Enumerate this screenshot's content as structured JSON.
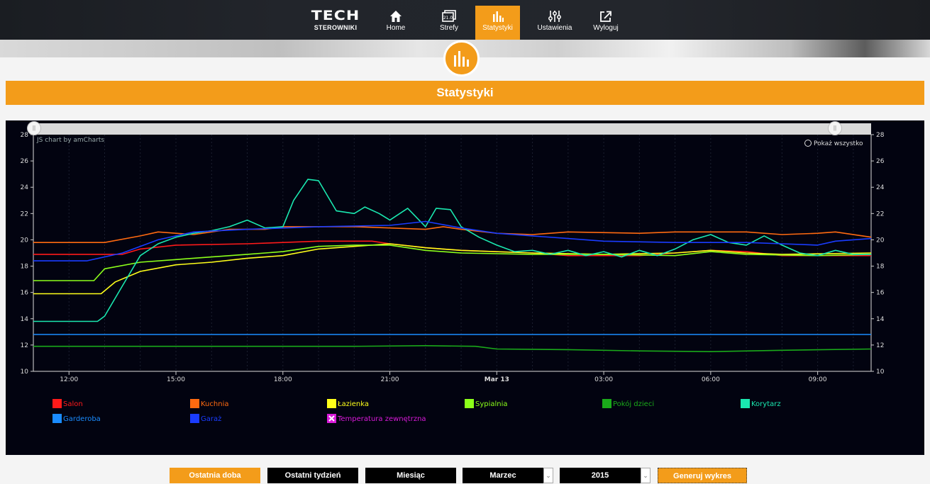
{
  "nav": {
    "logo_top": "TECH",
    "logo_bottom": "STEROWNIKI",
    "items": [
      {
        "label": "Home",
        "icon": "home-icon"
      },
      {
        "label": "Strefy",
        "icon": "zones-icon",
        "icon_text": "21.0"
      },
      {
        "label": "Statystyki",
        "icon": "bar-chart-icon",
        "active": true
      },
      {
        "label": "Ustawienia",
        "icon": "sliders-icon"
      },
      {
        "label": "Wyloguj",
        "icon": "logout-icon"
      }
    ]
  },
  "page": {
    "title": "Statystyki"
  },
  "chart_header": {
    "credit": "JS chart by amCharts",
    "zoom_out": "Pokaż wszystko"
  },
  "chart_data": {
    "type": "line",
    "y_ticks": [
      10,
      12,
      14,
      16,
      18,
      20,
      22,
      24,
      26,
      28
    ],
    "ylim": [
      10,
      28
    ],
    "xlim": [
      11.0,
      34.5
    ],
    "x_ticks": [
      {
        "x": 12,
        "label": "12:00"
      },
      {
        "x": 15,
        "label": "15:00"
      },
      {
        "x": 18,
        "label": "18:00"
      },
      {
        "x": 21,
        "label": "21:00"
      },
      {
        "x": 24,
        "label": "Mar 13",
        "bold": true
      },
      {
        "x": 27,
        "label": "03:00"
      },
      {
        "x": 30,
        "label": "06:00"
      },
      {
        "x": 33,
        "label": "09:00"
      }
    ],
    "series": [
      {
        "name": "Salon",
        "color": "#ff1a1a",
        "points": [
          [
            11,
            18.9
          ],
          [
            13.5,
            18.9
          ],
          [
            14,
            19.3
          ],
          [
            15,
            19.6
          ],
          [
            17,
            19.7
          ],
          [
            18,
            19.8
          ],
          [
            19,
            19.9
          ],
          [
            20.5,
            19.9
          ],
          [
            21,
            19.7
          ],
          [
            22,
            19.4
          ],
          [
            23,
            19.2
          ],
          [
            25,
            19.0
          ],
          [
            26,
            18.8
          ],
          [
            28,
            18.8
          ],
          [
            29,
            19.0
          ],
          [
            30,
            19.2
          ],
          [
            31,
            19.1
          ],
          [
            32,
            18.8
          ],
          [
            34.5,
            18.8
          ]
        ]
      },
      {
        "name": "Kuchnia",
        "color": "#ff6a10",
        "points": [
          [
            11,
            19.8
          ],
          [
            13,
            19.8
          ],
          [
            14,
            20.3
          ],
          [
            14.5,
            20.6
          ],
          [
            15.5,
            20.4
          ],
          [
            16.5,
            20.8
          ],
          [
            17.5,
            20.8
          ],
          [
            18,
            21.0
          ],
          [
            20,
            21.0
          ],
          [
            21,
            20.9
          ],
          [
            22,
            20.8
          ],
          [
            22.5,
            21.0
          ],
          [
            23,
            20.8
          ],
          [
            24,
            20.5
          ],
          [
            25,
            20.4
          ],
          [
            26,
            20.6
          ],
          [
            28,
            20.5
          ],
          [
            29,
            20.6
          ],
          [
            31,
            20.6
          ],
          [
            32,
            20.4
          ],
          [
            33,
            20.5
          ],
          [
            33.5,
            20.6
          ],
          [
            34.5,
            20.2
          ]
        ]
      },
      {
        "name": "Łazienka",
        "color": "#ffff1a",
        "points": [
          [
            11,
            15.9
          ],
          [
            12.9,
            15.9
          ],
          [
            13.3,
            16.8
          ],
          [
            14,
            17.6
          ],
          [
            15,
            18.1
          ],
          [
            16,
            18.3
          ],
          [
            17,
            18.6
          ],
          [
            18,
            18.8
          ],
          [
            19,
            19.3
          ],
          [
            20,
            19.5
          ],
          [
            21,
            19.7
          ],
          [
            22,
            19.4
          ],
          [
            23,
            19.2
          ],
          [
            25,
            19.0
          ],
          [
            27,
            18.9
          ],
          [
            29,
            19.0
          ],
          [
            30,
            19.2
          ],
          [
            31,
            19.0
          ],
          [
            32,
            18.9
          ],
          [
            34.5,
            19.0
          ]
        ]
      },
      {
        "name": "Sypialnia",
        "color": "#8cff1a",
        "points": [
          [
            11,
            16.9
          ],
          [
            12.7,
            16.9
          ],
          [
            13,
            17.8
          ],
          [
            14,
            18.3
          ],
          [
            15,
            18.5
          ],
          [
            16,
            18.7
          ],
          [
            17,
            18.9
          ],
          [
            18,
            19.1
          ],
          [
            19,
            19.5
          ],
          [
            20,
            19.6
          ],
          [
            21,
            19.6
          ],
          [
            22,
            19.2
          ],
          [
            23,
            19.0
          ],
          [
            25,
            18.9
          ],
          [
            27,
            18.9
          ],
          [
            29,
            18.8
          ],
          [
            30,
            19.1
          ],
          [
            31,
            18.9
          ],
          [
            33,
            18.8
          ],
          [
            34.5,
            18.9
          ]
        ]
      },
      {
        "name": "Pokój dzieci",
        "color": "#1aaa1a",
        "points": [
          [
            11,
            11.9
          ],
          [
            20,
            11.9
          ],
          [
            22,
            11.95
          ],
          [
            23.4,
            11.9
          ],
          [
            24,
            11.7
          ],
          [
            26,
            11.65
          ],
          [
            28,
            11.55
          ],
          [
            30,
            11.5
          ],
          [
            32,
            11.6
          ],
          [
            34.5,
            11.7
          ]
        ]
      },
      {
        "name": "Korytarz",
        "color": "#1ae8b0",
        "points": [
          [
            11,
            13.8
          ],
          [
            12.8,
            13.8
          ],
          [
            13,
            14.2
          ],
          [
            13.5,
            16.5
          ],
          [
            14,
            18.8
          ],
          [
            14.5,
            19.7
          ],
          [
            15,
            20.2
          ],
          [
            15.5,
            20.5
          ],
          [
            16,
            20.7
          ],
          [
            16.5,
            21.0
          ],
          [
            17,
            21.5
          ],
          [
            17.5,
            20.9
          ],
          [
            18,
            21.0
          ],
          [
            18.3,
            23.0
          ],
          [
            18.7,
            24.6
          ],
          [
            19,
            24.5
          ],
          [
            19.5,
            22.2
          ],
          [
            20,
            22.0
          ],
          [
            20.3,
            22.5
          ],
          [
            20.7,
            22.0
          ],
          [
            21,
            21.5
          ],
          [
            21.5,
            22.4
          ],
          [
            22,
            21.0
          ],
          [
            22.3,
            22.4
          ],
          [
            22.7,
            22.3
          ],
          [
            23,
            21.0
          ],
          [
            23.5,
            20.2
          ],
          [
            24,
            19.6
          ],
          [
            24.5,
            19.1
          ],
          [
            25,
            19.2
          ],
          [
            25.5,
            18.9
          ],
          [
            26,
            19.2
          ],
          [
            26.5,
            18.8
          ],
          [
            27,
            19.1
          ],
          [
            27.5,
            18.7
          ],
          [
            28,
            19.2
          ],
          [
            28.5,
            18.8
          ],
          [
            29,
            19.3
          ],
          [
            29.5,
            20.0
          ],
          [
            30,
            20.4
          ],
          [
            30.5,
            19.8
          ],
          [
            31,
            19.6
          ],
          [
            31.5,
            20.3
          ],
          [
            32,
            19.6
          ],
          [
            32.5,
            19.0
          ],
          [
            33,
            18.8
          ],
          [
            33.5,
            19.2
          ],
          [
            34,
            18.9
          ],
          [
            34.5,
            18.9
          ]
        ]
      },
      {
        "name": "Garderoba",
        "color": "#1a8cff",
        "points": [
          [
            11,
            12.8
          ],
          [
            34.5,
            12.8
          ]
        ]
      },
      {
        "name": "Garaż",
        "color": "#1a3cff",
        "points": [
          [
            11,
            18.4
          ],
          [
            12.5,
            18.4
          ],
          [
            13.5,
            19.0
          ],
          [
            14.5,
            20.0
          ],
          [
            15.5,
            20.6
          ],
          [
            17,
            20.8
          ],
          [
            19,
            21.0
          ],
          [
            21,
            21.1
          ],
          [
            22,
            21.4
          ],
          [
            23,
            20.9
          ],
          [
            24,
            20.5
          ],
          [
            25,
            20.3
          ],
          [
            26,
            20.1
          ],
          [
            27,
            19.9
          ],
          [
            29,
            19.8
          ],
          [
            31,
            19.8
          ],
          [
            32,
            19.7
          ],
          [
            33,
            19.6
          ],
          [
            33.5,
            19.9
          ],
          [
            34.5,
            20.1
          ]
        ]
      }
    ]
  },
  "legend": [
    {
      "label": "Salon",
      "color": "#ff1a1a",
      "row": 0,
      "col": 0
    },
    {
      "label": "Kuchnia",
      "color": "#ff6a10",
      "row": 0,
      "col": 1
    },
    {
      "label": "Łazienka",
      "color": "#ffff1a",
      "row": 0,
      "col": 2
    },
    {
      "label": "Sypialnia",
      "color": "#8cff1a",
      "row": 0,
      "col": 3
    },
    {
      "label": "Pokój dzieci",
      "color": "#1aaa1a",
      "row": 0,
      "col": 4
    },
    {
      "label": "Korytarz",
      "color": "#1ae8b0",
      "row": 0,
      "col": 5
    },
    {
      "label": "Garderoba",
      "color": "#1a8cff",
      "row": 1,
      "col": 0
    },
    {
      "label": "Garaż",
      "color": "#1a3cff",
      "row": 1,
      "col": 1
    },
    {
      "label": "Temperatura zewnętrzna",
      "color": "#d91ad9",
      "row": 1,
      "col": 2,
      "hidden": true
    }
  ],
  "controls": {
    "last_day": "Ostatnia doba",
    "last_week": "Ostatni tydzień",
    "month": "Miesiąc",
    "month_select": "Marzec",
    "year_select": "2015",
    "generate": "Generuj wykres"
  }
}
